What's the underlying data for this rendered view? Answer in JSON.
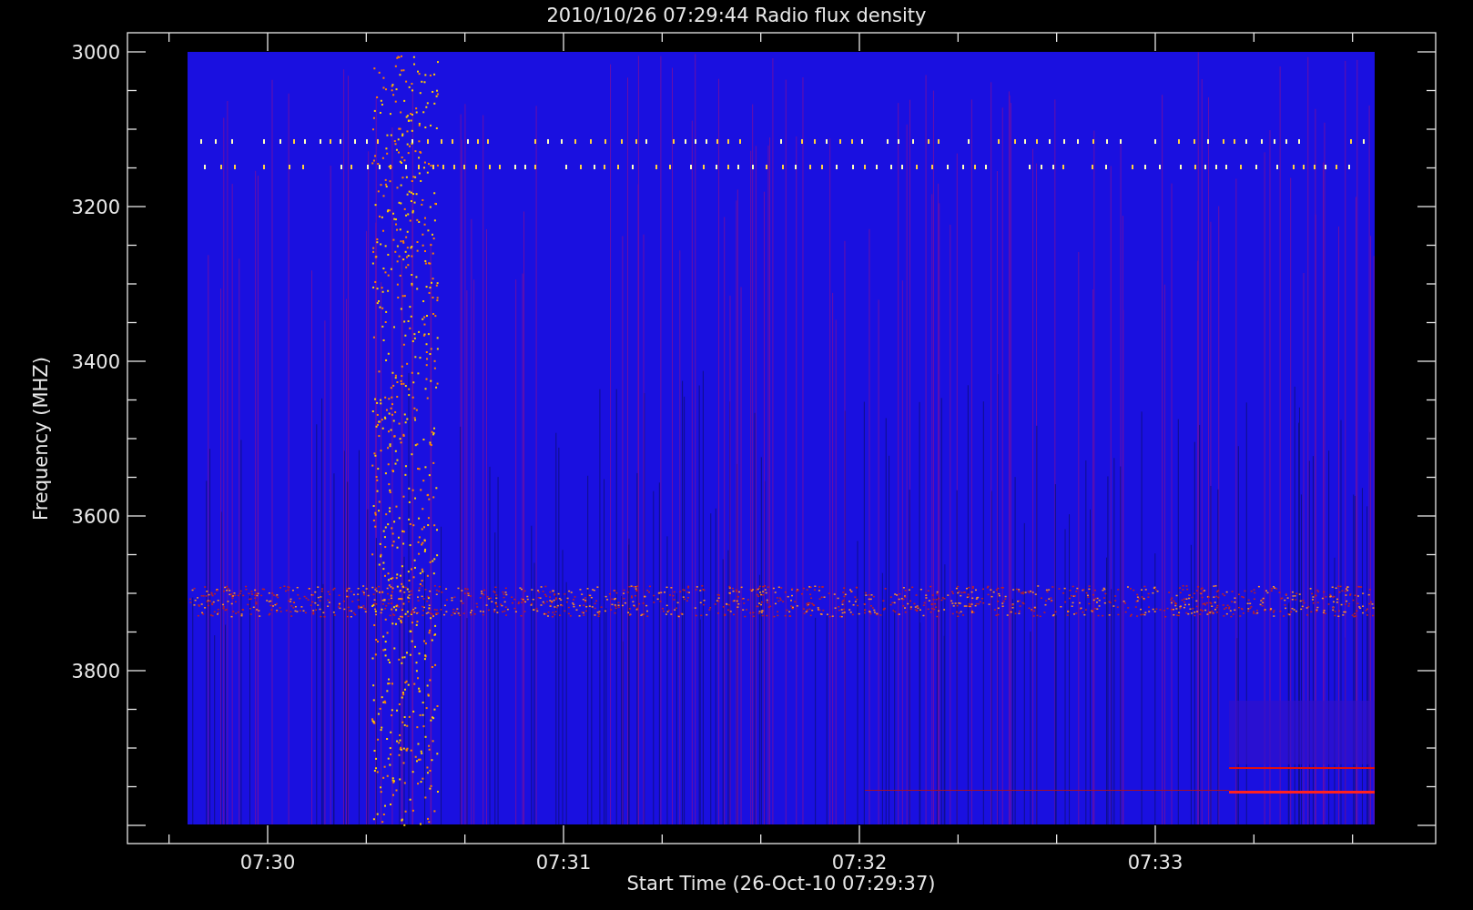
{
  "plot": {
    "title": "2010/10/26 07:29:44 Radio flux density",
    "ylabel": "Frequency (MHZ)",
    "xlabel": "Start Time (26-Oct-10 07:29:37)",
    "yticks": [
      "3000",
      "3200",
      "3400",
      "3600",
      "3800"
    ],
    "xticks": [
      "07:30",
      "07:31",
      "07:32",
      "07:33"
    ]
  }
}
